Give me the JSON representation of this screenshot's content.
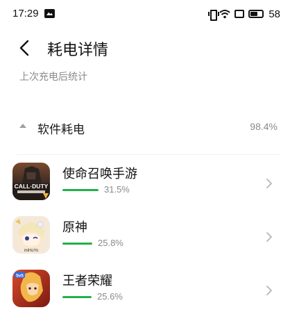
{
  "status_bar": {
    "time": "17:29",
    "battery_level": "58",
    "icons": [
      "gallery-notification-icon",
      "vibrate-icon",
      "wifi-icon",
      "sim-icon",
      "battery-icon"
    ]
  },
  "header": {
    "back_icon": "chevron-left-icon",
    "title": "耗电详情",
    "subtitle": "上次充电后统计"
  },
  "section": {
    "collapse_icon": "triangle-up-icon",
    "label": "软件耗电",
    "value": "98.4%"
  },
  "apps": [
    {
      "name": "使命召唤手游",
      "percent": "31.5%",
      "share": 0.315,
      "icon": "call-of-duty-app-icon"
    },
    {
      "name": "原神",
      "percent": "25.8%",
      "share": 0.258,
      "icon": "genshin-impact-app-icon"
    },
    {
      "name": "王者荣耀",
      "percent": "25.6%",
      "share": 0.256,
      "icon": "honor-of-kings-app-icon"
    }
  ],
  "colors": {
    "accent_green": "#21b04b",
    "text_secondary": "#8a8a8a"
  }
}
